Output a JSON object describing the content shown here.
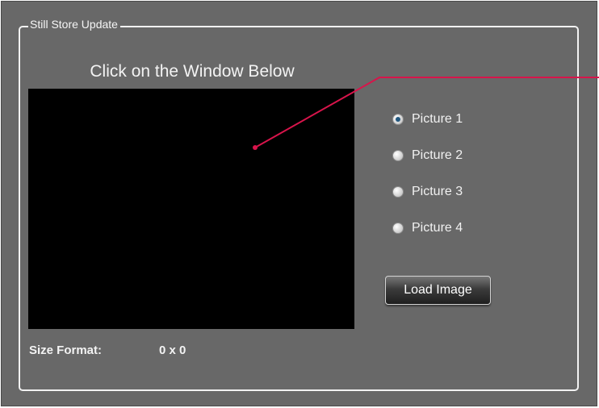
{
  "group": {
    "title": "Still Store Update"
  },
  "preview": {
    "instruction": "Click on the Window Below"
  },
  "pictures": {
    "options": [
      {
        "label": "Picture 1",
        "selected": true
      },
      {
        "label": "Picture 2",
        "selected": false
      },
      {
        "label": "Picture 3",
        "selected": false
      },
      {
        "label": "Picture 4",
        "selected": false
      }
    ]
  },
  "actions": {
    "load_label": "Load Image"
  },
  "size_format": {
    "label": "Size Format:",
    "value": "0 x 0"
  },
  "colors": {
    "panel_bg": "#686868",
    "preview_bg": "#000000",
    "annotation": "#d8144b",
    "radio_selected": "#22577f",
    "text": "#f3f3f3"
  }
}
